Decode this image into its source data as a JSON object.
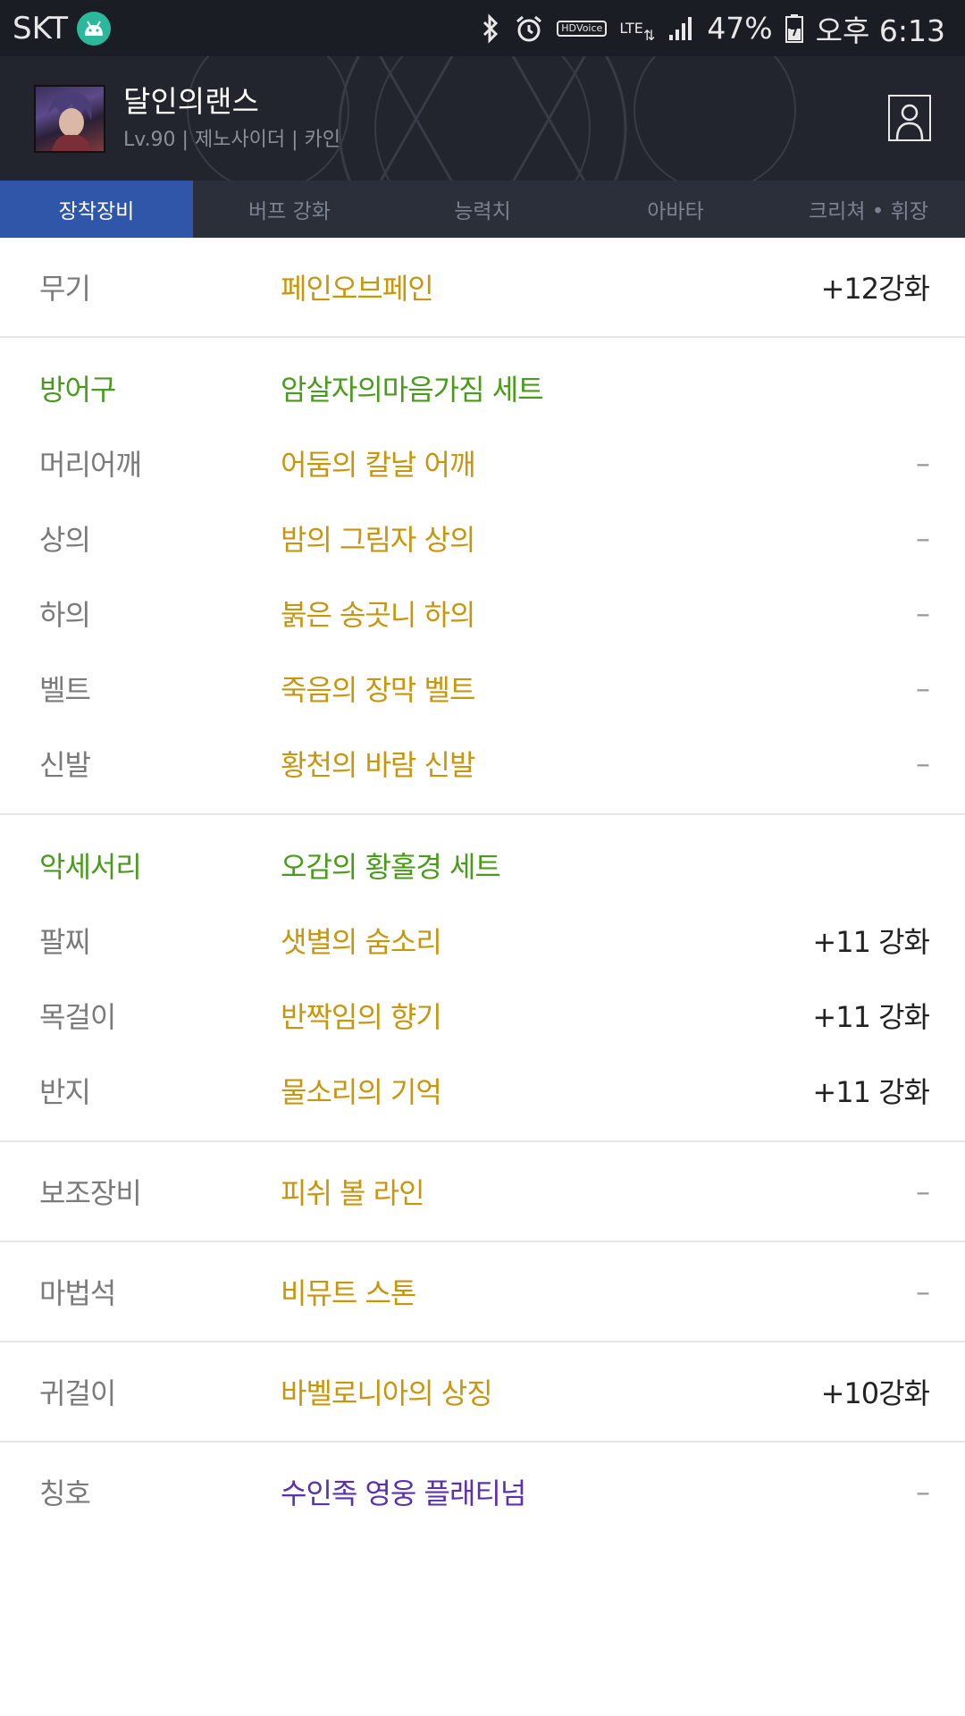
{
  "status_bar": {
    "carrier": "SKT",
    "hd": "HD",
    "voice": "Voice",
    "network": "LTE",
    "battery": "47%",
    "time": "오후 6:13"
  },
  "profile": {
    "name": "달인의랜스",
    "info": "Lv.90 | 제노사이더 | 카인"
  },
  "tabs": [
    {
      "label": "장착장비",
      "active": true
    },
    {
      "label": "버프 강화",
      "active": false
    },
    {
      "label": "능력치",
      "active": false
    },
    {
      "label": "아바타",
      "active": false
    },
    {
      "label": "크리쳐 • 휘장",
      "active": false
    }
  ],
  "weapon": {
    "slot": "무기",
    "item": "페인오브페인",
    "enhance": "+12강화"
  },
  "armor": {
    "header": {
      "slot": "방어구",
      "set": "암살자의마음가짐 세트"
    },
    "items": [
      {
        "slot": "머리어깨",
        "item": "어둠의 칼날 어깨",
        "enhance": "–"
      },
      {
        "slot": "상의",
        "item": "밤의 그림자 상의",
        "enhance": "–"
      },
      {
        "slot": "하의",
        "item": "붉은 송곳니 하의",
        "enhance": "–"
      },
      {
        "slot": "벨트",
        "item": "죽음의 장막 벨트",
        "enhance": "–"
      },
      {
        "slot": "신발",
        "item": "황천의 바람 신발",
        "enhance": "–"
      }
    ]
  },
  "accessory": {
    "header": {
      "slot": "악세서리",
      "set": "오감의 황홀경 세트"
    },
    "items": [
      {
        "slot": "팔찌",
        "item": "샛별의 숨소리",
        "enhance": "+11 강화"
      },
      {
        "slot": "목걸이",
        "item": "반짝임의 향기",
        "enhance": "+11 강화"
      },
      {
        "slot": "반지",
        "item": "물소리의 기억",
        "enhance": "+11 강화"
      }
    ]
  },
  "sub_equip": {
    "slot": "보조장비",
    "item": "피쉬 볼 라인",
    "enhance": "–"
  },
  "magic_stone": {
    "slot": "마법석",
    "item": "비뮤트 스톤",
    "enhance": "–"
  },
  "earring": {
    "slot": "귀걸이",
    "item": "바벨로니아의 상징",
    "enhance": "+10강화"
  },
  "title": {
    "slot": "칭호",
    "item": "수인족 영웅 플래티넘",
    "enhance": "–"
  },
  "colors": {
    "tab_active": "#2f56a8",
    "item_gold": "#c8960c",
    "set_green": "#4a9a1c",
    "title_purple": "#5a2fb0"
  }
}
